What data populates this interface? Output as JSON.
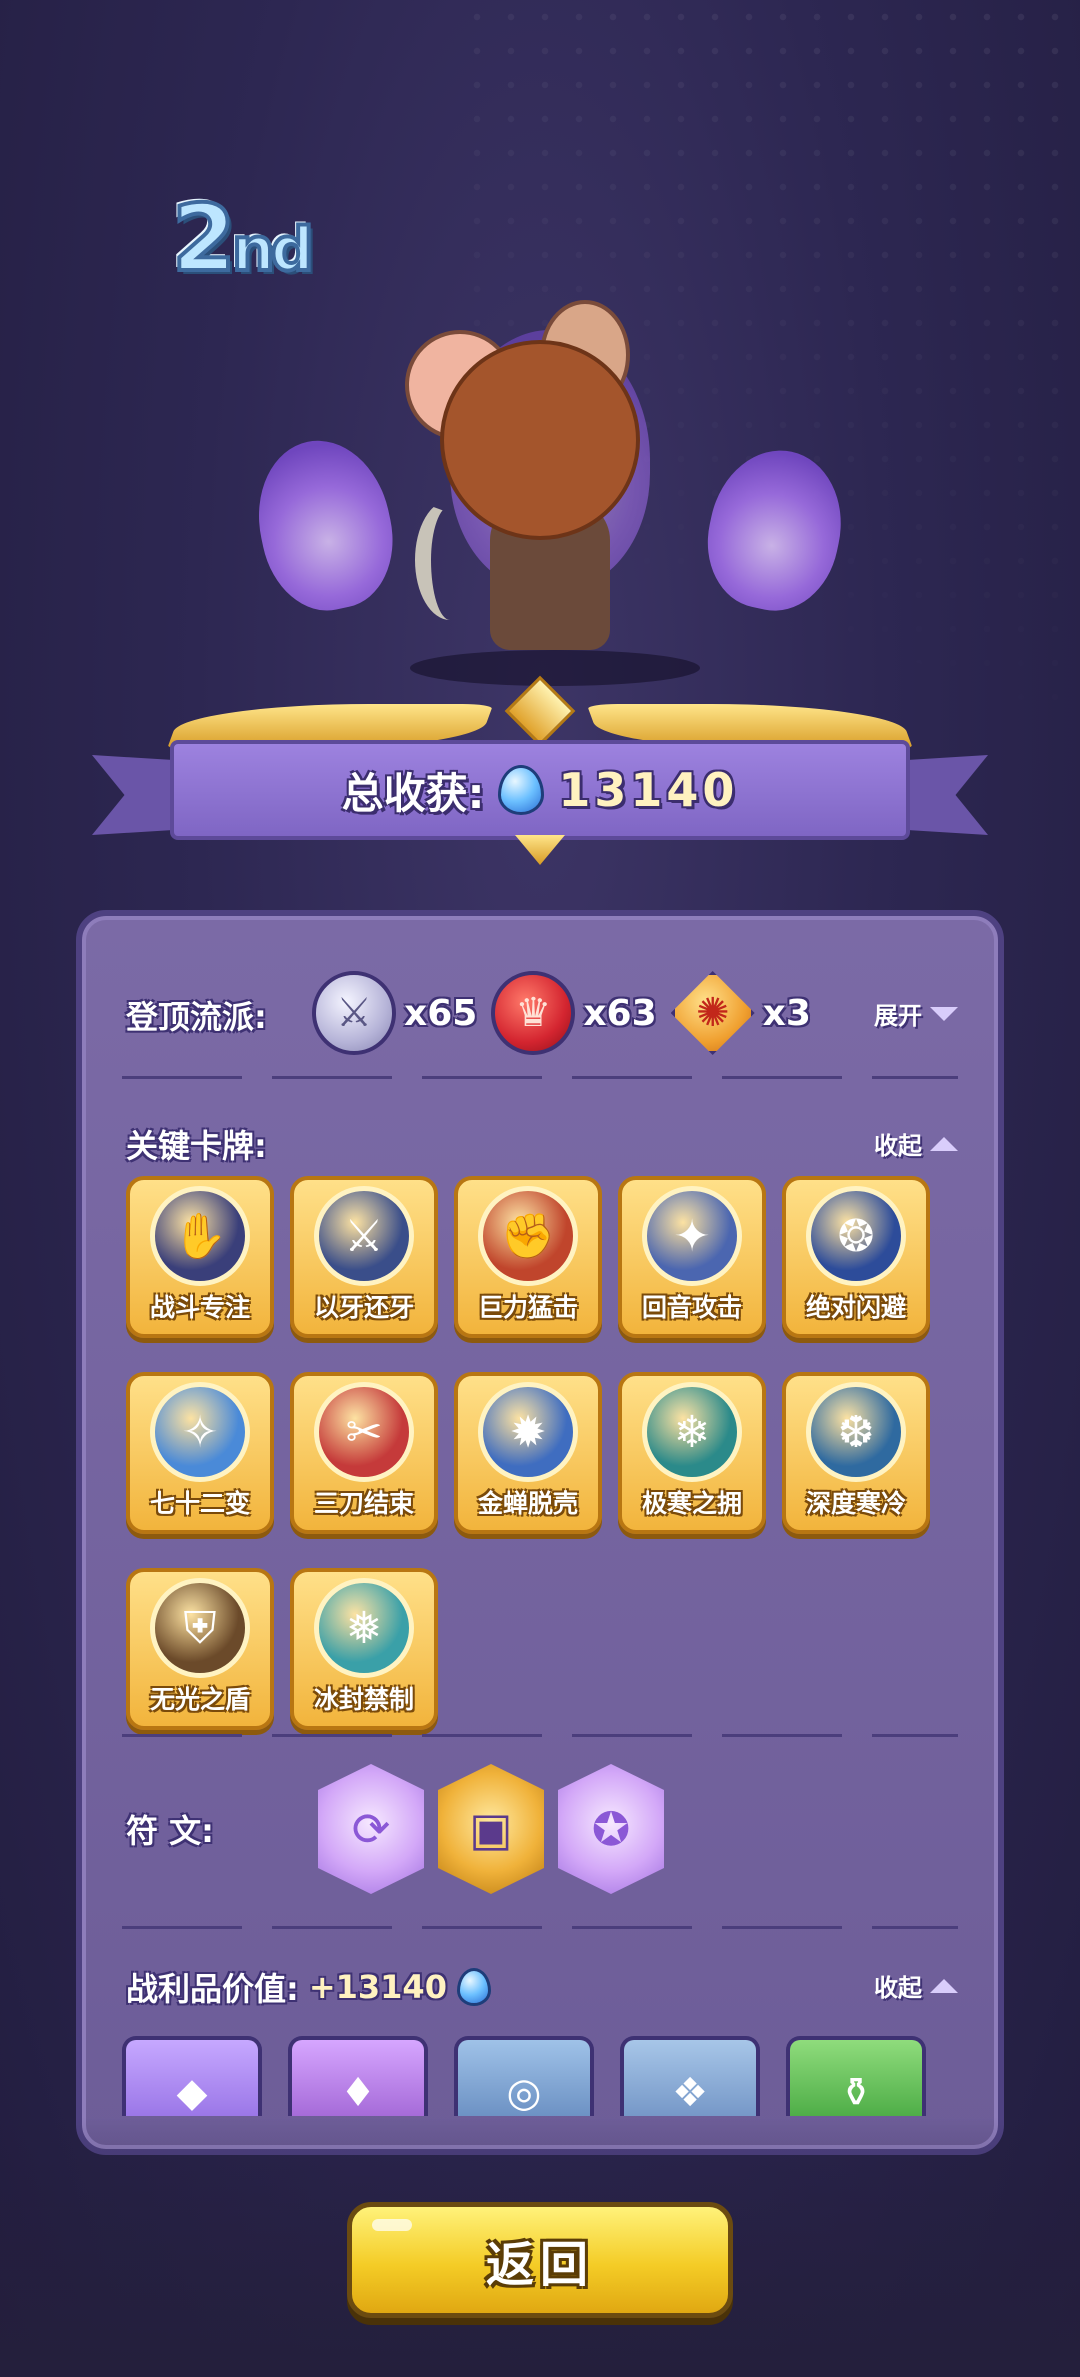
{
  "rank": {
    "num": "2",
    "suffix": "nd"
  },
  "total": {
    "label": "总收获:",
    "value": "13140"
  },
  "climb_school": {
    "label": "登顶流派:",
    "toggle": "展开",
    "items": [
      {
        "icon": "sword-icon",
        "count": "x65"
      },
      {
        "icon": "crown-icon",
        "count": "x63"
      },
      {
        "icon": "swirl-icon",
        "count": "x3"
      }
    ]
  },
  "key_cards": {
    "label": "关键卡牌:",
    "toggle": "收起",
    "cards": [
      {
        "name": "战斗专注",
        "color": "#3a3f7a"
      },
      {
        "name": "以牙还牙",
        "color": "#3a4e8a"
      },
      {
        "name": "巨力猛击",
        "color": "#c0452c"
      },
      {
        "name": "回音攻击",
        "color": "#4b66b0"
      },
      {
        "name": "绝对闪避",
        "color": "#2d4c9a"
      },
      {
        "name": "七十二变",
        "color": "#4a8ad8"
      },
      {
        "name": "三刀结束",
        "color": "#c53a3a"
      },
      {
        "name": "金蝉脱壳",
        "color": "#3f6dc0"
      },
      {
        "name": "极寒之拥",
        "color": "#2b8a8a"
      },
      {
        "name": "深度寒冷",
        "color": "#2f6aa0"
      },
      {
        "name": "无光之盾",
        "color": "#6b4a2a"
      },
      {
        "name": "冰封禁制",
        "color": "#3aa0a8"
      }
    ]
  },
  "runes": {
    "label": "符   文:",
    "items": [
      {
        "style": "purple",
        "icon": "arrows-icon"
      },
      {
        "style": "gold",
        "icon": "card-icon"
      },
      {
        "style": "purple",
        "icon": "orbs-icon"
      }
    ]
  },
  "loot": {
    "label": "战利品价值:",
    "value": "+13140",
    "toggle": "收起"
  },
  "return_button": "返回"
}
